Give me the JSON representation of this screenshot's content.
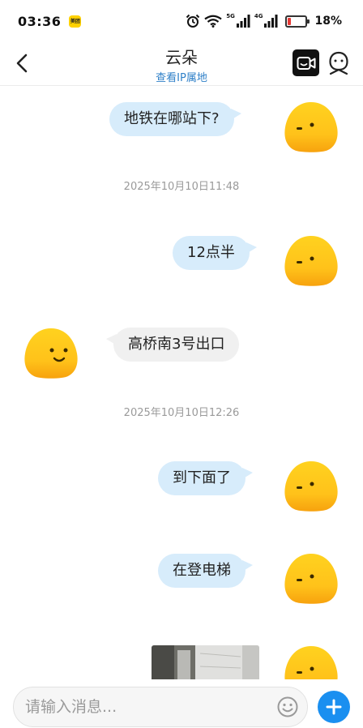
{
  "status_bar": {
    "time": "03:36",
    "app_badge": "美团",
    "signal_1_label": "5G",
    "signal_2_label": "4G",
    "battery_percent": 18,
    "battery_text": "18%"
  },
  "header": {
    "contact_name": "云朵",
    "ip_link": "查看IP属地"
  },
  "messages": [
    {
      "type": "text",
      "direction": "out",
      "text": "地铁在哪站下?"
    },
    {
      "type": "timestamp",
      "text": "2025年10月10日11:48"
    },
    {
      "type": "text",
      "direction": "out",
      "text": "12点半"
    },
    {
      "type": "text",
      "direction": "in",
      "text": "高桥南3号出口"
    },
    {
      "type": "timestamp",
      "text": "2025年10月10日12:26"
    },
    {
      "type": "text",
      "direction": "out",
      "text": "到下面了"
    },
    {
      "type": "text",
      "direction": "out",
      "text": "在登电梯"
    },
    {
      "type": "image",
      "direction": "out"
    }
  ],
  "input": {
    "placeholder": "请输入消息..."
  },
  "colors": {
    "outgoing_bubble": "#d7ecfb",
    "incoming_bubble": "#f0f0f0",
    "link": "#2f80c8",
    "accent": "#1a8ff0",
    "avatar": "#ffc61a"
  },
  "icons": {
    "back": "chevron-left-icon",
    "video_call": "video-camera-icon",
    "profile": "user-profile-icon",
    "emoji": "smiley-icon",
    "add": "plus-icon"
  }
}
